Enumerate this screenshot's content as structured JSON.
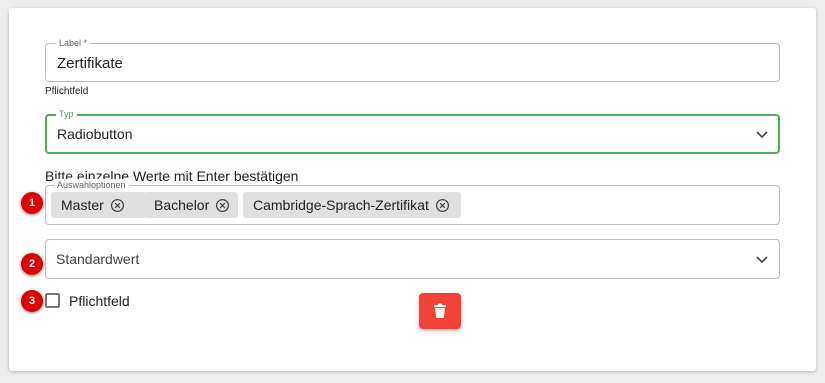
{
  "label_field": {
    "legend": "Label *",
    "value": "Zertifikate",
    "helper": "Pflichtfeld"
  },
  "type_field": {
    "legend": "Typ",
    "value": "Radiobutton",
    "accent_color": "#4caf50"
  },
  "options_field": {
    "hint": "Bitte einzelne Werte mit Enter bestätigen",
    "legend": "Auswahloptionen",
    "chips": [
      "Master",
      "Bachelor",
      "Cambridge-Sprach-Zertifikat"
    ]
  },
  "default_field": {
    "placeholder": "Standardwert"
  },
  "required_checkbox": {
    "label": "Pflichtfeld",
    "checked": false
  },
  "delete_button": {
    "icon": "trash-icon",
    "color": "#f44336"
  },
  "badges": [
    "1",
    "2",
    "3"
  ],
  "badge_color": "#e00000"
}
